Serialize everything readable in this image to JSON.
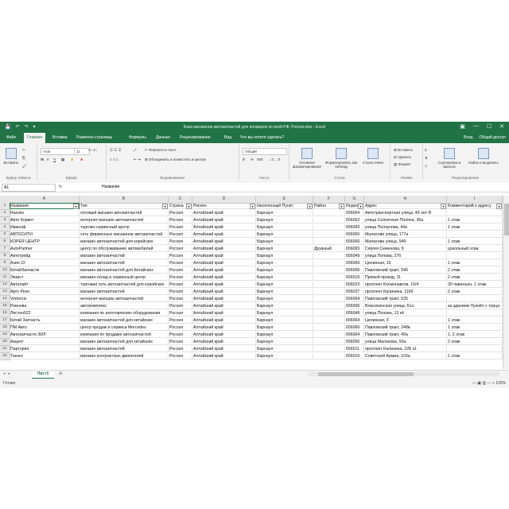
{
  "title_bar": {
    "quick_access": [
      "💾",
      "↶",
      "↷",
      "▾"
    ],
    "title": "База магазинов автозапчастей для иномарок по всей РФ, Россия.xlsx - Excel",
    "window_controls": [
      "▣",
      "—",
      "☐",
      "✕"
    ]
  },
  "ribbon_tabs": {
    "tabs": [
      "Файл",
      "Главная",
      "Вставка",
      "Разметка страницы",
      "Формулы",
      "Данные",
      "Рецензирование",
      "Вид",
      "Что вы хотите сделать?"
    ],
    "active_index": 1,
    "signin": "Вход",
    "share": "Общий доступ"
  },
  "ribbon": {
    "clipboard": {
      "paste": "Вставить",
      "name": "Буфер обмена"
    },
    "font": {
      "font_name": "Arial",
      "font_size": "11",
      "bold": "Ж",
      "italic": "К",
      "underline": "Ч",
      "name": "Шрифт"
    },
    "alignment": {
      "wrap_text": "Перенести текст",
      "merge": "Объединить и поместить в центре",
      "name": "Выравнивание"
    },
    "number": {
      "format": "Общий",
      "percent": "%",
      "thousands": "000",
      "name": "Число"
    },
    "styles": {
      "conditional": "Условное форматирование",
      "as_table": "Форматировать как таблицу",
      "cell_styles": "Стили ячеек",
      "name": "Стили"
    },
    "cells": {
      "insert": "Вставить",
      "delete": "Удалить",
      "format": "Формат",
      "name": "Ячейки"
    },
    "editing": {
      "sum": "Σ",
      "sort": "Сортировка и фильтр",
      "find": "Найти и выделить",
      "name": "Редактирование"
    }
  },
  "formula_bar": {
    "name_box": "A1",
    "fx": "fx",
    "content": "Название"
  },
  "columns": [
    {
      "letter": "A"
    },
    {
      "letter": "B"
    },
    {
      "letter": "C"
    },
    {
      "letter": "D"
    },
    {
      "letter": "E"
    },
    {
      "letter": "F"
    },
    {
      "letter": "G"
    },
    {
      "letter": "H"
    },
    {
      "letter": "I"
    }
  ],
  "rows": [
    {
      "n": "1",
      "cells": [
        "Название",
        "Тип",
        "Страна",
        "Регион",
        "Населенный Пункт",
        "Район",
        "Индекс",
        "Адрес",
        "Комментарий к адресу"
      ]
    },
    {
      "n": "2",
      "cells": [
        "Rassko",
        "оптовый магазин автозапчастей",
        "Россия",
        "Алтайский край",
        "Барнаул",
        "",
        "656064",
        "Автотранспортная улица, 49 лит В",
        ""
      ]
    },
    {
      "n": "3",
      "cells": [
        "Авто Корвет",
        "интернет-магазин автозапчастей",
        "Россия",
        "Алтайский край",
        "Барнаул",
        "",
        "656062",
        "улица Солнечная Поляна, 36а",
        "1 этаж"
      ]
    },
    {
      "n": "4",
      "cells": [
        "Иваноф",
        "торгово-сервисный центр",
        "Россия",
        "Алтайский край",
        "Барнаул",
        "",
        "656043",
        "улица Ползунова, 44а",
        "1 этаж"
      ]
    },
    {
      "n": "5",
      "cells": [
        "АВТОСИТИ",
        "сеть фирменных магазинов автозапчастей",
        "Россия",
        "Алтайский край",
        "Барнаул",
        "",
        "656056",
        "Малахова улица, 177а",
        ""
      ]
    },
    {
      "n": "6",
      "cells": [
        "КОРЕЯ ЦЕНТР",
        "магазин автозапчастей для корейских",
        "Россия",
        "Алтайский край",
        "Барнаул",
        "",
        "656066",
        "Малахова улица, 94б",
        "1 этаж"
      ]
    },
    {
      "n": "7",
      "cells": [
        "AutoPartner",
        "центр по обслуживанию автомобилей",
        "Россия",
        "Алтайский край",
        "Барнаул",
        "Дружный",
        "656065",
        "Сергея Семенова, 9",
        "цокольный этаж"
      ]
    },
    {
      "n": "8",
      "cells": [
        "Автотрейд",
        "магазин автозапчастей",
        "Россия",
        "Алтайский край",
        "Барнаул",
        "",
        "656049",
        "улица Попова, 27б",
        ""
      ]
    },
    {
      "n": "9",
      "cells": [
        "Азия 22",
        "магазин автозапчастей",
        "Россия",
        "Алтайский край",
        "Барнаул",
        "",
        "656066",
        "Целинная, 15",
        "1 этаж"
      ]
    },
    {
      "n": "10",
      "cells": [
        "КитайЗапчасти",
        "магазин автозапчастей для Китайских",
        "Россия",
        "Алтайский край",
        "Барнаул",
        "",
        "656006",
        "Павловский тракт, 54б",
        "2 этаж"
      ]
    },
    {
      "n": "11",
      "cells": [
        "Экзист",
        "магазин-склад и сервисный центр",
        "Россия",
        "Алтайский край",
        "Барнаул",
        "",
        "656015",
        "Прямой проезд, 11",
        "2 этаж"
      ]
    },
    {
      "n": "12",
      "cells": [
        "Автолайт",
        "торговая сеть автозапчастей для корейских",
        "Россия",
        "Алтайский край",
        "Барнаул",
        "",
        "656023",
        "проспект Космонавтов, 10/4",
        "30 павильон, 1 этаж"
      ]
    },
    {
      "n": "13",
      "cells": [
        "Арго Рено",
        "магазин автозапчастей",
        "Россия",
        "Алтайский край",
        "Барнаул",
        "",
        "656037",
        "проспект Калинина, 116б",
        "2 этаж"
      ]
    },
    {
      "n": "14",
      "cells": [
        "Vomorus",
        "интернет-магазин автозапчастей",
        "Россия",
        "Алтайский край",
        "Барнаул",
        "",
        "656064",
        "Павловский тракт, 535",
        ""
      ]
    },
    {
      "n": "15",
      "cells": [
        "Ровнова",
        "автокомплекс",
        "Россия",
        "Алтайский край",
        "Барнаул",
        "",
        "656006",
        "Власихинская улица, 61а",
        "за зданием Лукойл с торца"
      ]
    },
    {
      "n": "16",
      "cells": [
        "Листон522",
        "компания по изготовлению оборудования",
        "Россия",
        "Алтайский край",
        "Барнаул",
        "",
        "656049",
        "улица Попова, 13 к4",
        ""
      ]
    },
    {
      "n": "17",
      "cells": [
        "Китай Запчасть",
        "магазин автозапчастей для китайских",
        "Россия",
        "Алтайский край",
        "Барнаул",
        "",
        "656064",
        "Целинная, 3",
        "1 этаж"
      ]
    },
    {
      "n": "18",
      "cells": [
        "ПМ Авто",
        "центр продаж и сервиса Mercedes",
        "Россия",
        "Алтайский край",
        "Барнаул",
        "",
        "656066",
        "Павловский тракт, 248в",
        "1 этаж"
      ]
    },
    {
      "n": "19",
      "cells": [
        "Автозапчасти ЗИЛ",
        "компания по продаже автозапчастей",
        "Россия",
        "Алтайский край",
        "Барнаул",
        "",
        "656064",
        "Павловский тракт, 49а",
        "1, 2 этаж"
      ]
    },
    {
      "n": "20",
      "cells": [
        "Акцент",
        "магазин автозапчастей для китайских",
        "Россия",
        "Алтайский край",
        "Барнаул",
        "",
        "656056",
        "улица Малахова, 93а",
        "2 этаж"
      ]
    },
    {
      "n": "21",
      "cells": [
        "Партория",
        "магазин автозапчастей",
        "Россия",
        "Алтайский край",
        "Барнаул",
        "",
        "656011",
        "проспект Калинина, 22Б к1",
        ""
      ]
    },
    {
      "n": "22",
      "cells": [
        "Тоекнс",
        "магазин контрактных двигателей",
        "Россия",
        "Алтайский край",
        "Барнаул",
        "",
        "656015",
        "Советской Армии, 103а",
        "1 этаж"
      ]
    }
  ],
  "sheet_bar": {
    "nav": [
      "◂",
      "▸"
    ],
    "sheet_name": "Лист1",
    "add": "⊕"
  },
  "status_bar": {
    "ready": "Готово",
    "zoom": "▭  ▣  ▥  —  +  100%"
  }
}
